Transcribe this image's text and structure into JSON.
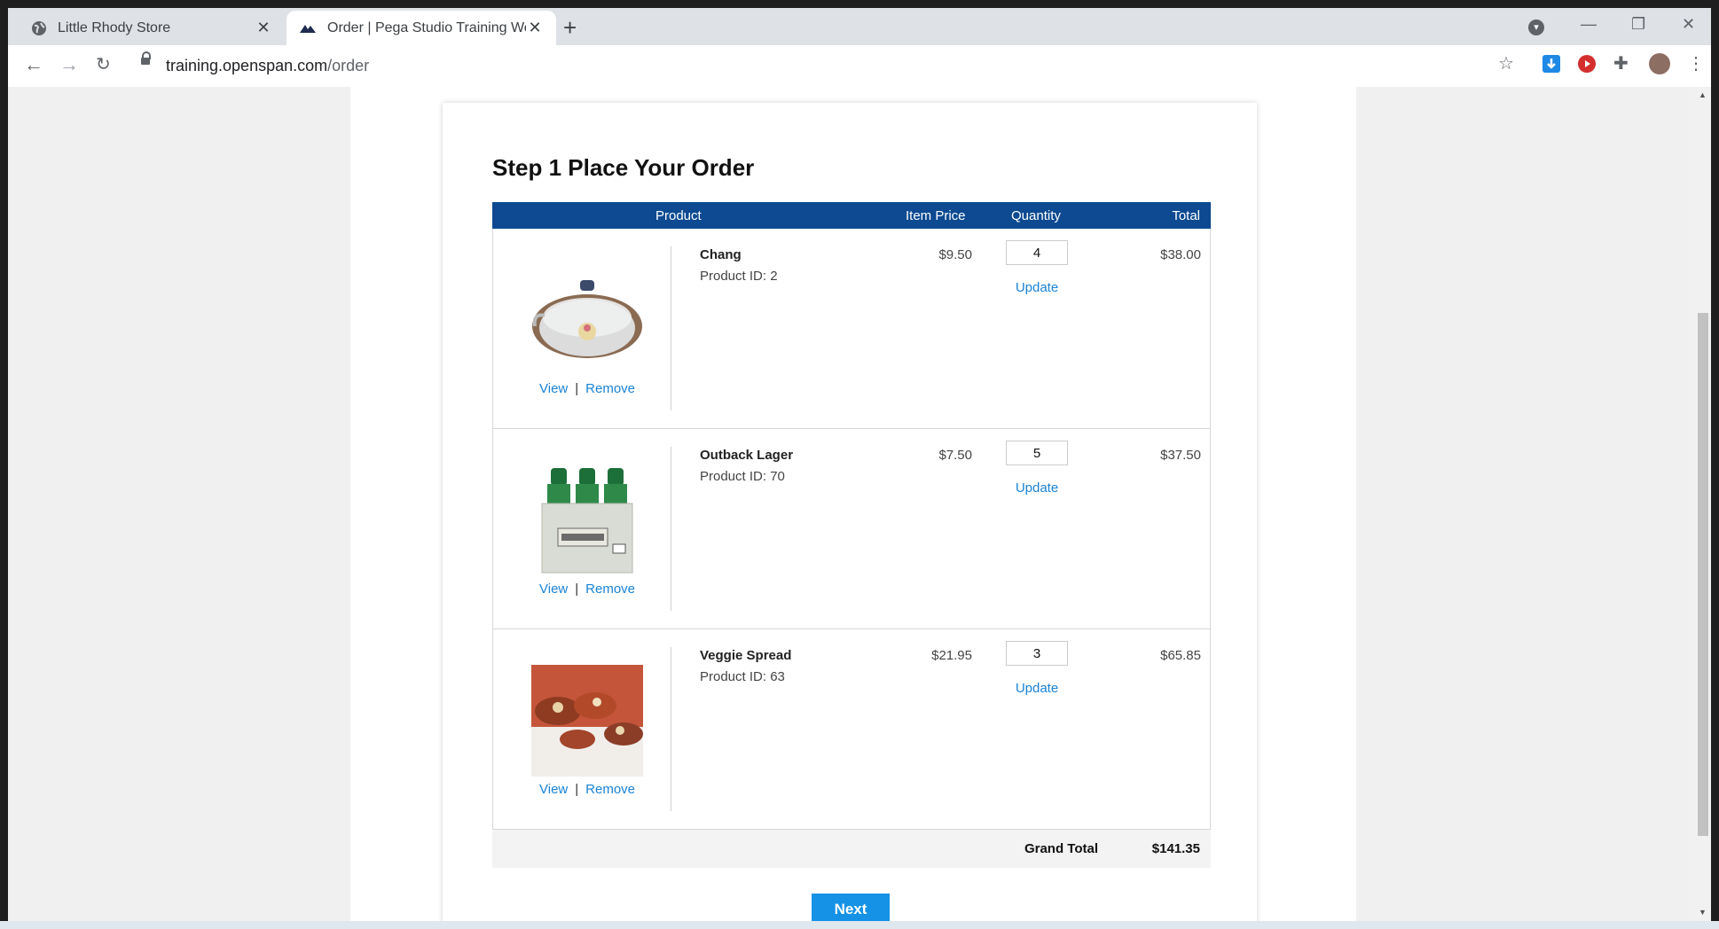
{
  "browser": {
    "tabs": [
      {
        "title": "Little Rhody Store",
        "active": false
      },
      {
        "title": "Order | Pega Studio Training Web",
        "active": true
      }
    ],
    "url_host": "training.openspan.com",
    "url_path": "/order"
  },
  "page": {
    "title": "Step 1 Place Your Order",
    "columns": {
      "product": "Product",
      "item_price": "Item Price",
      "quantity": "Quantity",
      "total": "Total"
    },
    "items": [
      {
        "name": "Chang",
        "product_id": "Product ID: 2",
        "price": "$9.50",
        "quantity": "4",
        "update": "Update",
        "total": "$38.00",
        "view": "View",
        "sep": "|",
        "remove": "Remove",
        "image": "glass-teapot"
      },
      {
        "name": "Outback Lager",
        "product_id": "Product ID: 70",
        "price": "$7.50",
        "quantity": "5",
        "update": "Update",
        "total": "$37.50",
        "view": "View",
        "sep": "|",
        "remove": "Remove",
        "image": "beer-six-pack"
      },
      {
        "name": "Veggie Spread",
        "product_id": "Product ID: 63",
        "price": "$21.95",
        "quantity": "3",
        "update": "Update",
        "total": "$65.85",
        "view": "View",
        "sep": "|",
        "remove": "Remove",
        "image": "bruschetta-plate"
      }
    ],
    "grand_total_label": "Grand Total",
    "grand_total_value": "$141.35",
    "next_label": "Next"
  },
  "colors": {
    "header_blue": "#0d4a91",
    "link_blue": "#1a83d6",
    "button_blue": "#1592e6"
  }
}
